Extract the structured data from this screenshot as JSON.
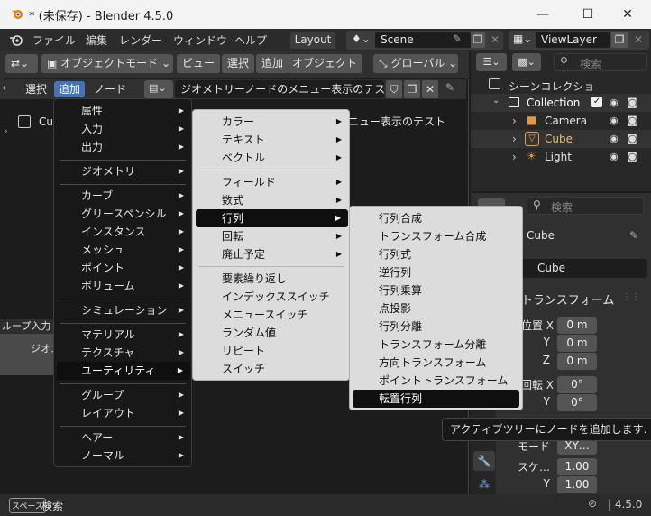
{
  "window": {
    "title": "* (未保存) - Blender 4.5.0",
    "minimize": "—",
    "maximize": "☐",
    "close": "✕"
  },
  "menubar": {
    "items": [
      "ファイル",
      "編集",
      "レンダー",
      "ウィンドウ",
      "ヘルプ"
    ],
    "workspace_tab": "Layout",
    "scene_label": "Scene",
    "viewlayer_label": "ViewLayer"
  },
  "toolbar": {
    "mode": "オブジェクトモード",
    "buttons": [
      "ビュー",
      "選択",
      "追加",
      "オブジェクト"
    ],
    "transform_orientation": "グローバル"
  },
  "node_header": {
    "menus": [
      "選択",
      "追加",
      "ノード"
    ],
    "tree_name": "ジオメトリーノードのメニュー表示のテスト"
  },
  "editor": {
    "object_label": "Cu",
    "bg_title": "ニュー表示のテスト",
    "node_left_label": "ループ入力",
    "node_left_sub": "ジオメ"
  },
  "add_menu": {
    "items": [
      "属性",
      "入力",
      "出力",
      "ジオメトリ",
      "カーブ",
      "グリースペンシル",
      "インスタンス",
      "メッシュ",
      "ポイント",
      "ボリューム",
      "シミュレーション",
      "マテリアル",
      "テクスチャ",
      "ユーティリティ",
      "グループ",
      "レイアウト",
      "ヘアー",
      "ノーマル"
    ],
    "highlighted": "ユーティリティ"
  },
  "utility_menu": {
    "items": [
      "カラー",
      "テキスト",
      "ベクトル",
      "フィールド",
      "数式",
      "行列",
      "回転",
      "廃止予定",
      "要素繰り返し",
      "インデックススイッチ",
      "メニュースイッチ",
      "ランダム値",
      "リピート",
      "スイッチ"
    ],
    "highlighted": "行列"
  },
  "matrix_menu": {
    "items": [
      "行列合成",
      "トランスフォーム合成",
      "行列式",
      "逆行列",
      "行列乗算",
      "点投影",
      "行列分離",
      "トランスフォーム分離",
      "方向トランスフォーム",
      "ポイントトランスフォーム",
      "転置行列"
    ],
    "highlighted": "転置行列"
  },
  "tooltip": {
    "text": "アクティブツリーにノードを追加します."
  },
  "outliner": {
    "search_placeholder": "検索",
    "scene_collection": "シーンコレクショ",
    "collection": "Collection",
    "objects": [
      "Camera",
      "Cube",
      "Light"
    ]
  },
  "properties": {
    "search_placeholder": "検索",
    "object_name": "Cube",
    "object_field": "Cube",
    "panel_title": "トランスフォーム",
    "location_label": "位置 X",
    "location": [
      "0 m",
      "0 m",
      "0 m"
    ],
    "rotation_label": "回転 X",
    "rotation": [
      "0°",
      "0°"
    ],
    "mode_label": "モード",
    "mode_value": "XY…",
    "scale_label": "スケ…",
    "scale": [
      "1.00",
      "1.00"
    ],
    "axis_y": "Y",
    "axis_z": "Z"
  },
  "statusbar": {
    "key": "スペース",
    "action": "検索",
    "version": "4.5.0"
  },
  "colors": {
    "accent": "#4772b3",
    "highlight": "#0f0f0f",
    "camera": "#e09a40",
    "cube": "#e8a050"
  }
}
